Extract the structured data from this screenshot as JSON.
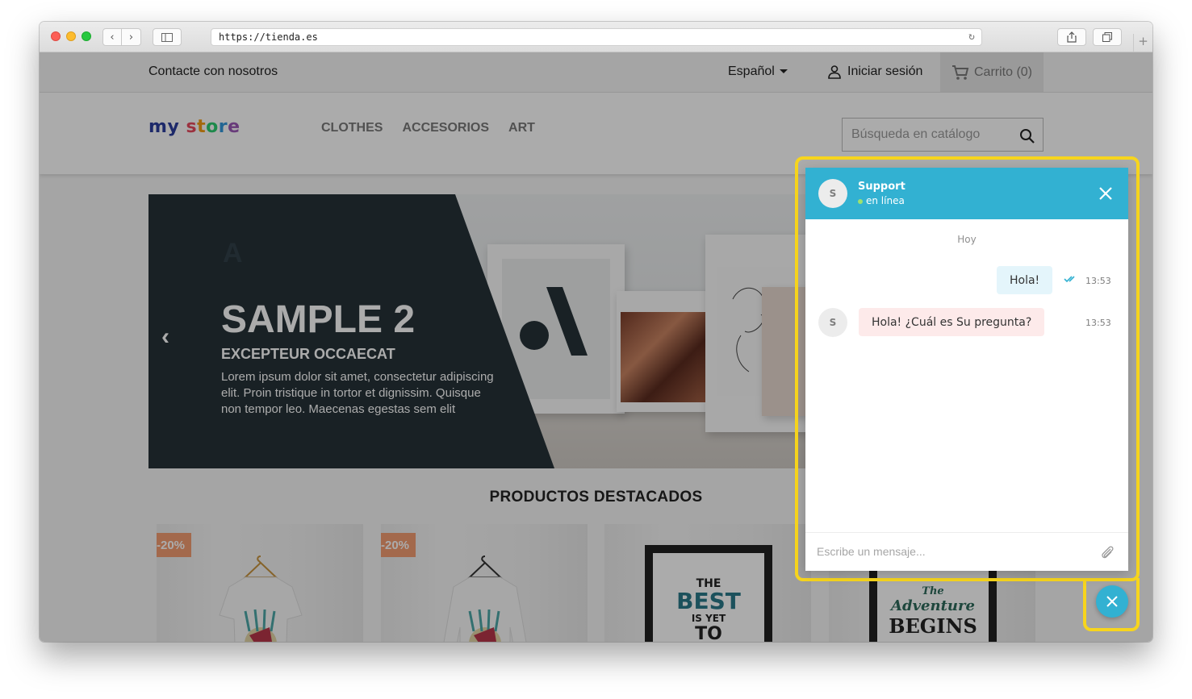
{
  "browser": {
    "url": "https://tienda.es"
  },
  "topbar": {
    "contact": "Contacte con nosotros",
    "language": "Español",
    "login": "Iniciar sesión",
    "cart": "Carrito (0)"
  },
  "header": {
    "logo": [
      "m",
      "y",
      " ",
      "s",
      "t",
      "o",
      "r",
      "e"
    ],
    "nav": [
      "CLOTHES",
      "ACCESORIOS",
      "ART"
    ],
    "search_placeholder": "Búsqueda en catálogo"
  },
  "banner": {
    "title": "SAMPLE 2",
    "subtitle": "EXCEPTEUR OCCAECAT",
    "text": "Lorem ipsum dolor sit amet, consectetur adipiscing elit. Proin tristique in tortor et dignissim. Quisque non tempor leo. Maecenas egestas sem elit"
  },
  "featured": {
    "heading": "PRODUCTOS DESTACADOS",
    "badges": [
      "-20%",
      "-20%"
    ],
    "poster1_lines": [
      "THE",
      "BEST",
      "IS YET",
      "TO"
    ],
    "poster2_lines": [
      "The",
      "Adventure",
      "BEGINS"
    ]
  },
  "chat": {
    "agent_initial": "S",
    "agent_name": "Support",
    "status": "en línea",
    "day_label": "Hoy",
    "messages": [
      {
        "direction": "out",
        "text": "Hola!",
        "time": "13:53"
      },
      {
        "direction": "in",
        "text": "Hola! ¿Cuál es Su pregunta?",
        "time": "13:53"
      }
    ],
    "input_placeholder": "Escribe un mensaje..."
  },
  "colors": {
    "chat_accent": "#32b1d2",
    "highlight": "#f7d51d",
    "badge": "#f39d72",
    "banner_dark": "#263238"
  }
}
